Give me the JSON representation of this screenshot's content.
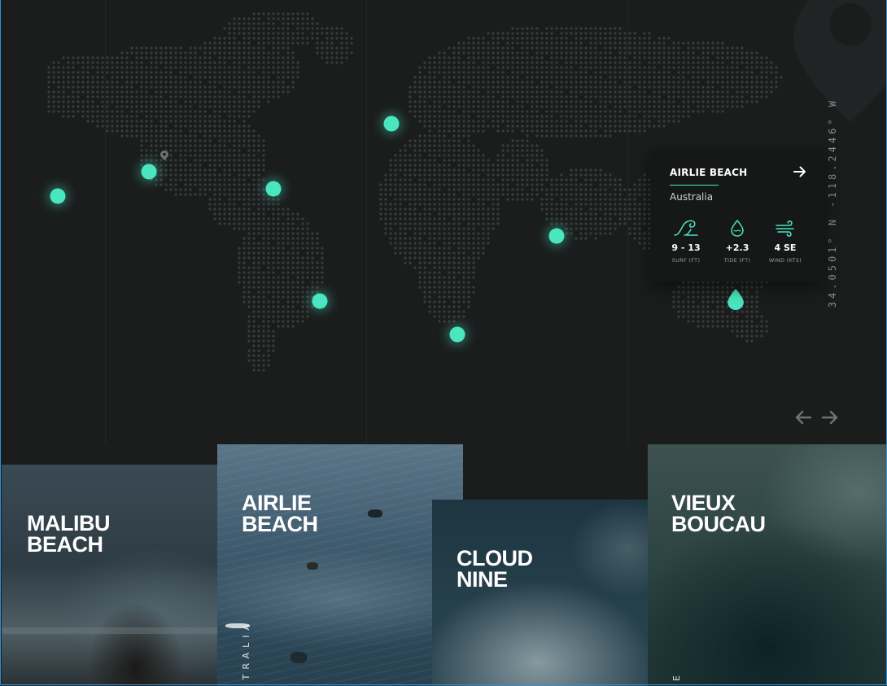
{
  "map": {
    "coordinates": "34.0501° N -118.2446° W",
    "accent": "#4ae6c0",
    "dot_color": "#3a3d3d",
    "location_pin_icon": "map-pin-icon"
  },
  "info_card": {
    "name": "AIRLIE BEACH",
    "country": "Australia",
    "arrow_icon": "arrow-right-icon",
    "stats": [
      {
        "icon": "wave-icon",
        "value": "9 - 13",
        "label": "SURF (FT)"
      },
      {
        "icon": "droplet-icon",
        "value": "+2.3",
        "label": "TIDE (FT)"
      },
      {
        "icon": "wind-icon",
        "value": "4 SE",
        "label": "WIND (KTS)"
      }
    ]
  },
  "carousel": {
    "prev_icon": "arrow-left-icon",
    "next_icon": "arrow-right-icon"
  },
  "cards": [
    {
      "title": "MALIBU\nBEACH",
      "side_label": ""
    },
    {
      "title": "AIRLIE\nBEACH",
      "side_label": "TRALIA"
    },
    {
      "title": "CLOUD\nNINE",
      "side_label": ""
    },
    {
      "title": "VIEUX\nBOUCAU",
      "side_label": "E"
    }
  ]
}
